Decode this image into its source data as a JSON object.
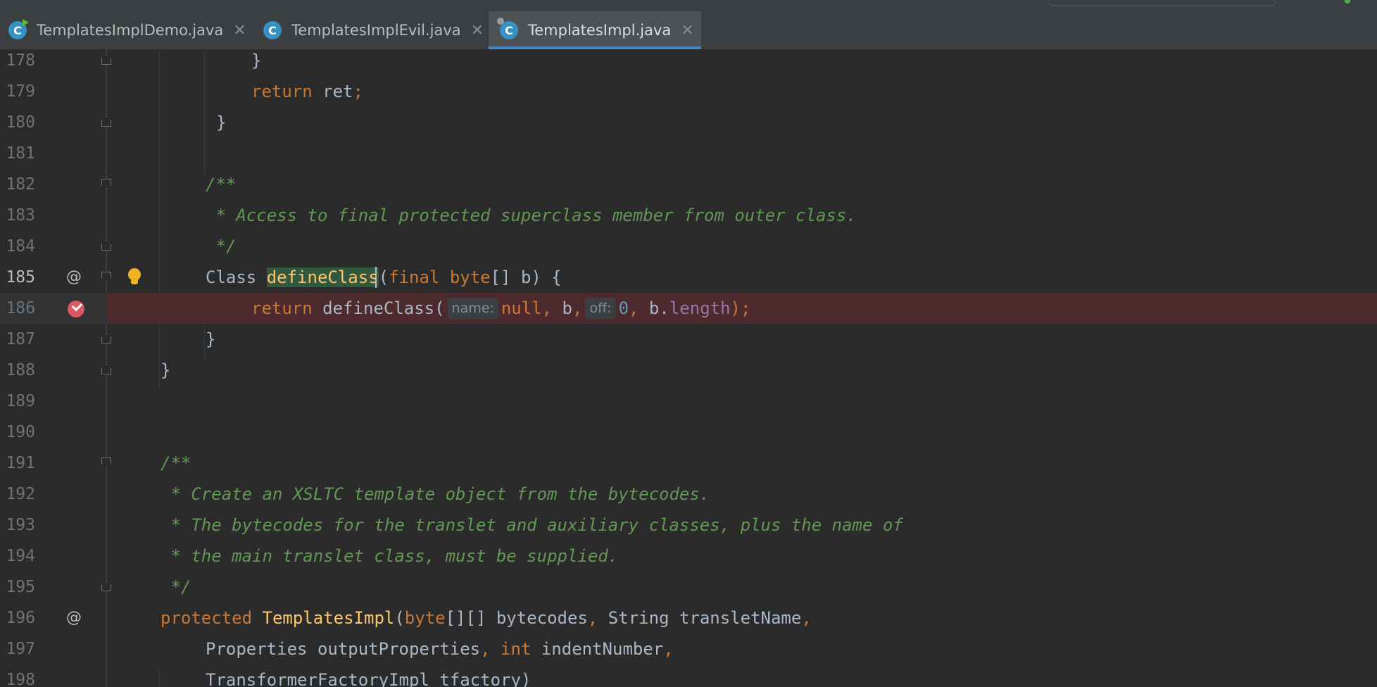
{
  "tabs": [
    {
      "label": "TemplatesImplDemo.java",
      "icon": "C",
      "active": false,
      "close": "✕"
    },
    {
      "label": "TemplatesImplEvil.java",
      "icon": "C",
      "active": false,
      "close": "✕"
    },
    {
      "label": "TemplatesImpl.java",
      "icon": "C",
      "active": true,
      "close": "✕"
    }
  ],
  "gutter": {
    "line_numbers": [
      "178",
      "179",
      "180",
      "181",
      "182",
      "183",
      "184",
      "185",
      "186",
      "187",
      "188",
      "189",
      "190",
      "191",
      "192",
      "193",
      "194",
      "195",
      "196",
      "197",
      "198"
    ],
    "at_marker": "@"
  },
  "code": {
    "l178": {
      "brace": "}"
    },
    "l179": {
      "kw_return": "return",
      "rest": " ret",
      "semi": ";"
    },
    "l180": {
      "brace": "}"
    },
    "l182": {
      "text": "/**"
    },
    "l183": {
      "text": " * Access to final protected superclass member from outer class."
    },
    "l184": {
      "text": " */"
    },
    "l185": {
      "type": "Class ",
      "name_a": "defineCla",
      "name_b": "ss",
      "open": "(",
      "kw_final": "final",
      "sp1": " ",
      "kw_byte": "byte",
      "rest": "[] b) {"
    },
    "l186": {
      "kw_return": "return",
      "call": " defineClass(",
      "hint_name": "name:",
      "kw_null": "null",
      "comma1": ",",
      "b": " b",
      "comma2": ",",
      "hint_off": "off:",
      "num": "0",
      "comma3": ",",
      "b2": " b.",
      "field": "length",
      "end": ");"
    },
    "l187": {
      "brace": "}"
    },
    "l188": {
      "brace": "}"
    },
    "l191": {
      "text": "/**"
    },
    "l192": {
      "text": " * Create an XSLTC template object from the bytecodes."
    },
    "l193": {
      "text": " * The bytecodes for the translet and auxiliary classes, plus the name of"
    },
    "l194": {
      "text": " * the main translet class, must be supplied."
    },
    "l195": {
      "text": " */"
    },
    "l196": {
      "kw_protected": "protected",
      "sp": " ",
      "ctor": "TemplatesImpl",
      "open": "(",
      "kw_byte": "byte",
      "a": "[][] bytecodes",
      "c1": ",",
      "b": " String transletName",
      "c2": ","
    },
    "l197": {
      "a": "Properties outputProperties",
      "c1": ",",
      "sp": " ",
      "kw_int": "int",
      "b": " indentNumber",
      "c2": ","
    },
    "l198": {
      "text": "TransformerFactoryImpl tfactory)"
    }
  }
}
